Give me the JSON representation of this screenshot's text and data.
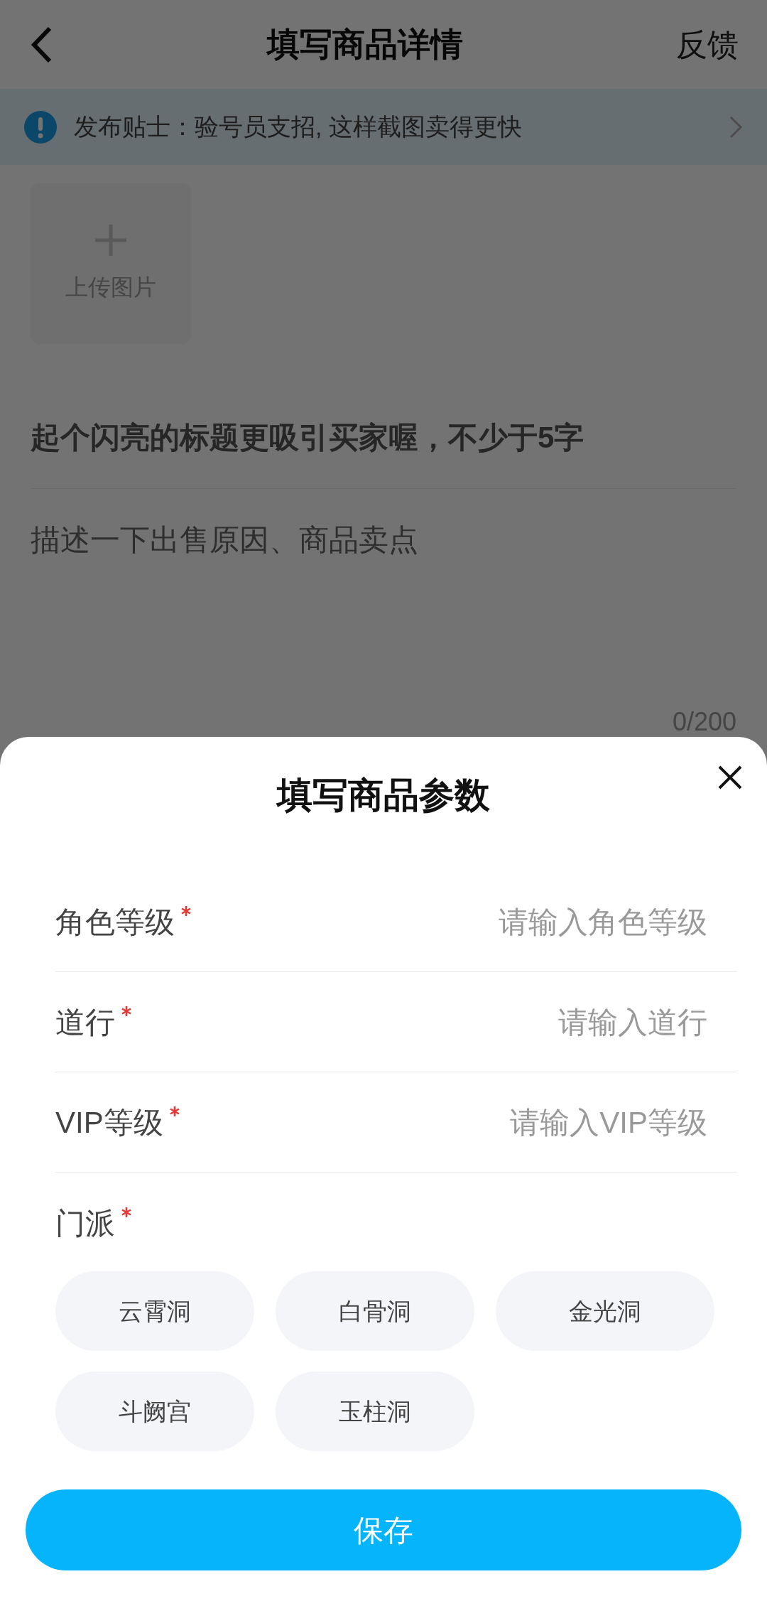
{
  "header": {
    "title": "填写商品详情",
    "action": "反馈"
  },
  "tip": {
    "text": "发布贴士：验号员支招, 这样截图卖得更快"
  },
  "upload": {
    "label": "上传图片"
  },
  "title_field": {
    "placeholder": "起个闪亮的标题更吸引买家喔，不少于5字"
  },
  "description_field": {
    "placeholder": "描述一下出售原因、商品卖点",
    "counter": "0/200"
  },
  "sheet": {
    "title": "填写商品参数",
    "fields": [
      {
        "label": "角色等级",
        "required": true,
        "placeholder": "请输入角色等级"
      },
      {
        "label": "道行",
        "required": true,
        "placeholder": "请输入道行"
      },
      {
        "label": "VIP等级",
        "required": true,
        "placeholder": "请输入VIP等级"
      }
    ],
    "sect": {
      "label": "门派",
      "required": true,
      "options": [
        {
          "label": "云霄洞",
          "selected": false
        },
        {
          "label": "白骨洞",
          "selected": false
        },
        {
          "label": "金光洞",
          "selected": false
        },
        {
          "label": "斗阙宫",
          "selected": false
        },
        {
          "label": "玉柱洞",
          "selected": false
        }
      ]
    },
    "save_button": "保存"
  }
}
